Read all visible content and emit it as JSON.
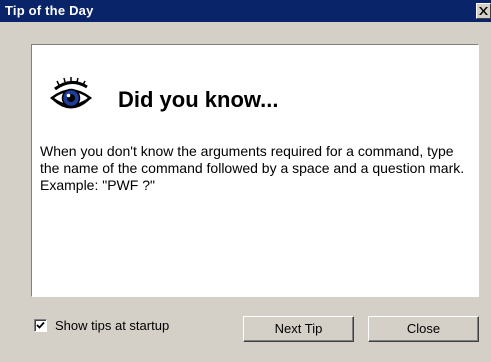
{
  "window": {
    "title": "Tip of the Day",
    "close_glyph": "✕"
  },
  "tip": {
    "icon": "eye-icon",
    "heading": "Did you know...",
    "text": "When you don't know the arguments required for a command, type the name of the command followed by a space and a question mark. Example: \"PWF ?\""
  },
  "footer": {
    "show_tips_label": "Show tips at startup",
    "show_tips_checked": true,
    "next_tip_label": "Next Tip",
    "close_label": "Close"
  },
  "colors": {
    "titlebar": "#0a246a",
    "face": "#d4d0c8"
  }
}
